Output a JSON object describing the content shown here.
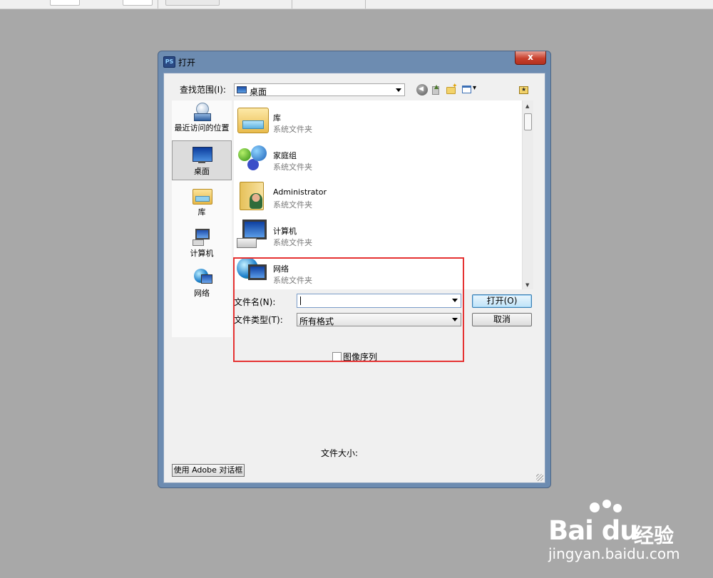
{
  "dialog": {
    "title": "打开",
    "app_icon": "PS",
    "close_glyph": "x"
  },
  "lookin": {
    "label": "查找范围(I):",
    "value": "桌面"
  },
  "places": [
    {
      "label": "最近访问的位置",
      "icon": "recent-places-icon"
    },
    {
      "label": "桌面",
      "icon": "desktop-icon",
      "selected": true
    },
    {
      "label": "库",
      "icon": "library-icon"
    },
    {
      "label": "计算机",
      "icon": "computer-icon"
    },
    {
      "label": "网络",
      "icon": "network-icon"
    }
  ],
  "files": [
    {
      "name": "库",
      "type": "系统文件夹",
      "icon": "library-icon"
    },
    {
      "name": "家庭组",
      "type": "系统文件夹",
      "icon": "homegroup-icon"
    },
    {
      "name": "Administrator",
      "type": "系统文件夹",
      "icon": "user-folder-icon"
    },
    {
      "name": "计算机",
      "type": "系统文件夹",
      "icon": "computer-icon"
    },
    {
      "name": "网络",
      "type": "系统文件夹",
      "icon": "network-icon"
    }
  ],
  "filename": {
    "label": "文件名(N):",
    "value": ""
  },
  "filetype": {
    "label": "文件类型(T):",
    "value": "所有格式"
  },
  "buttons": {
    "open": "打开(O)",
    "cancel": "取消",
    "adobe_dialog": "使用 Adobe 对话框"
  },
  "image_sequence": {
    "label": "图像序列",
    "checked": false
  },
  "file_size_label": "文件大小:",
  "watermark": {
    "brand": "Bai du",
    "suffix": "经验",
    "url": "jingyan.baidu.com"
  },
  "colors": {
    "highlight": "#e53232",
    "dialog_frame": "#6d8cb1",
    "background": "#a8a8a8"
  }
}
